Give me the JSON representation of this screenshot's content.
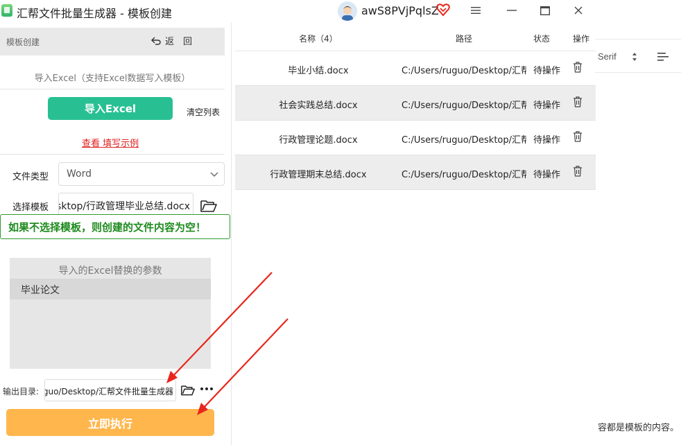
{
  "window": {
    "title": "汇帮文件批量生成器 - 模板创建",
    "user_name": "awS8PVjPqlsZ"
  },
  "left_panel": {
    "header_title": "模板创建",
    "back_label": "返　回",
    "import_hint": "导入Excel（支持Excel数据写入模板）",
    "import_button": "导入Excel",
    "clear_list": "清空列表",
    "example_link": "查看 填写示例",
    "file_type_label": "文件类型",
    "file_type_value": "Word",
    "template_label": "选择模板",
    "template_path": "sktop/行政管理毕业总结.docx",
    "warning": "如果不选择模板，则创建的文件内容为空！",
    "param_title": "导入的Excel替换的参数",
    "param_items": [
      "毕业论文"
    ],
    "output_label": "输出目录:",
    "output_path": "guo/Desktop/汇帮文件批量生成器",
    "run_button": "立即执行"
  },
  "table": {
    "headers": {
      "name": "名称（4）",
      "path": "路径",
      "status": "状态",
      "op": "操作"
    },
    "rows": [
      {
        "name": "毕业小结.docx",
        "path": "C:/Users/ruguo/Desktop/汇帮文",
        "status": "待操作"
      },
      {
        "name": "社会实践总结.docx",
        "path": "C:/Users/ruguo/Desktop/汇帮文",
        "status": "待操作"
      },
      {
        "name": "行政管理论题.docx",
        "path": "C:/Users/ruguo/Desktop/汇帮文",
        "status": "待操作"
      },
      {
        "name": "行政管理期末总结.docx",
        "path": "C:/Users/ruguo/Desktop/汇帮文",
        "status": "待操作"
      }
    ]
  },
  "background": {
    "font_name": "Serif",
    "footer_text": "容都是模板的内容。"
  },
  "colors": {
    "import_button": "#28c093",
    "run_button": "#ffb74d",
    "warning": "#1e8b1e",
    "link": "#e02020",
    "arrow": "#e8261c"
  },
  "icons": [
    "app-icon",
    "avatar",
    "vip-heart-icon",
    "menu-icon",
    "minimize-icon",
    "maximize-icon",
    "close-icon",
    "back-icon",
    "chevron-down-icon",
    "folder-icon",
    "more-icon",
    "trash-icon"
  ]
}
